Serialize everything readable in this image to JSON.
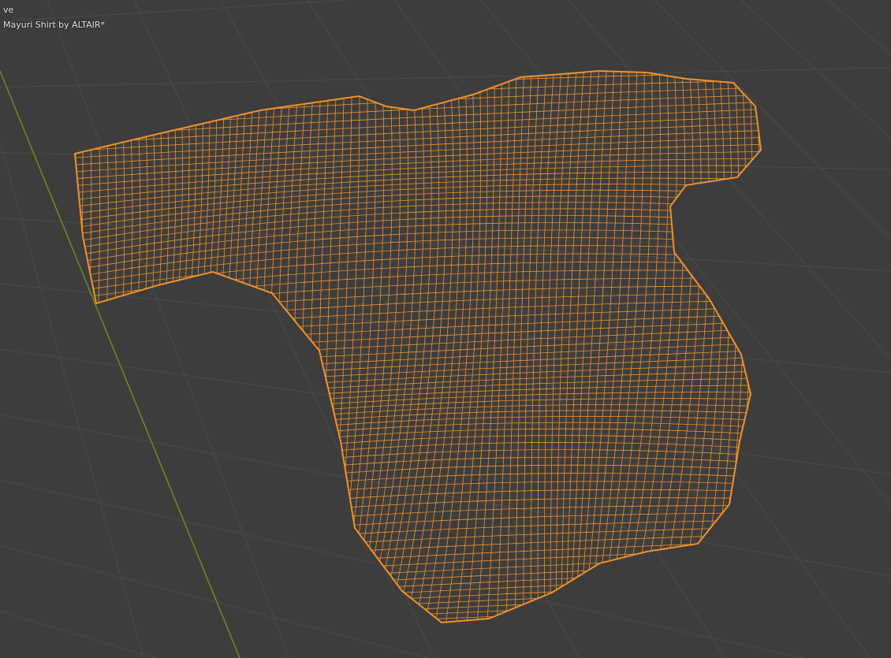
{
  "viewport": {
    "mode_text": "ve",
    "object_name": "Mayuri Shirt by ALTAIR*"
  },
  "colors": {
    "background": "#3d3d3d",
    "grid": "#4b4b4b",
    "y_axis": "#6b8e2a",
    "wireframe": "#f0922a"
  }
}
